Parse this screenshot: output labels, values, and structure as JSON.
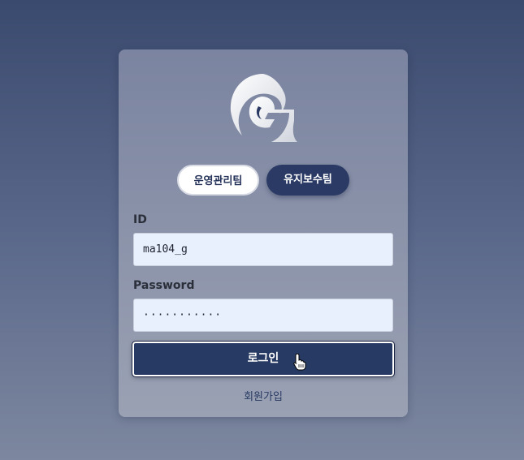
{
  "team_toggle": {
    "operations_label": "운영관리팀",
    "maintenance_label": "유지보수팀",
    "selected": "유지보수팀"
  },
  "form": {
    "id_label": "ID",
    "id_value": "ma104_g",
    "password_label": "Password",
    "password_masked": "···········"
  },
  "actions": {
    "login_label": "로그인",
    "signup_label": "회원가입"
  },
  "colors": {
    "primary": "#273a63",
    "input_bg": "#e8effd"
  },
  "icons": {
    "logo": "wave-g-logo-icon",
    "cursor": "hand-pointer-icon"
  }
}
